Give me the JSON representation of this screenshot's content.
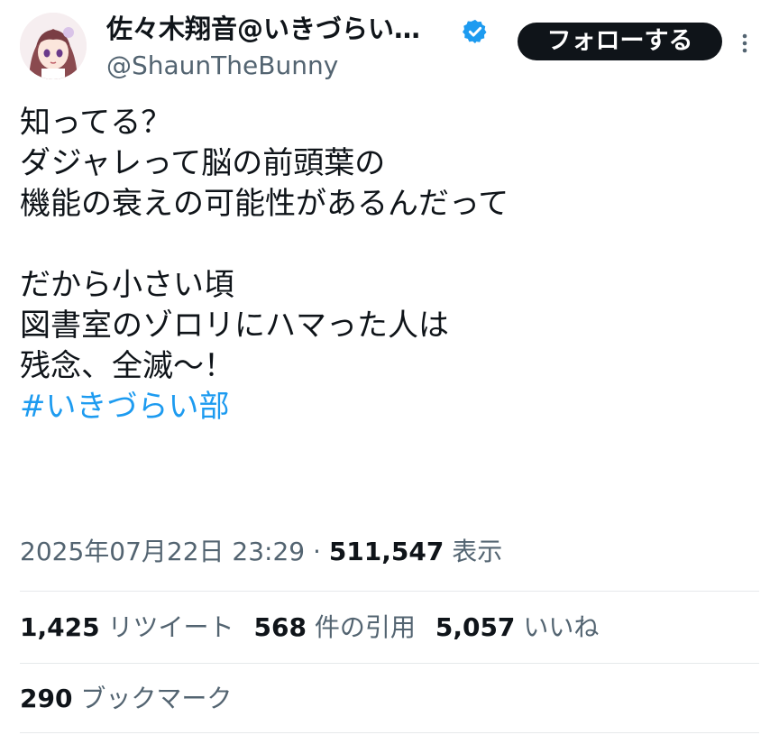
{
  "author": {
    "display_name": "佐々木翔音@いきづらい…",
    "handle": "@ShaunTheBunny",
    "verified": true
  },
  "follow_button": {
    "label": "フォローする"
  },
  "tweet": {
    "lines": [
      "知ってる？",
      "ダジャレって脳の前頭葉の",
      "機能の衰えの可能性があるんだって",
      "",
      "だから小さい頃",
      "図書室のゾロリにハマった人は",
      "残念、全滅～！"
    ],
    "hashtag": "#いきづらい部"
  },
  "meta": {
    "timestamp": "2025年07月22日 23:29",
    "separator": " · ",
    "views_count": "511,547",
    "views_label": " 表示"
  },
  "stats": {
    "retweets": {
      "count": "1,425",
      "label": " リツイート"
    },
    "quotes": {
      "count": "568",
      "label": " 件の引用"
    },
    "likes": {
      "count": "5,057",
      "label": " いいね"
    },
    "bookmarks": {
      "count": "290",
      "label": " ブックマーク"
    }
  },
  "colors": {
    "text": "#0f1419",
    "secondary": "#536471",
    "accent": "#1d9bf0",
    "button_bg": "#0f1419",
    "button_text": "#ffffff",
    "divider": "#e6e9eb"
  },
  "icons": {
    "verified": "verified-badge-icon",
    "more": "more-vertical-icon",
    "avatar": "anime-avatar"
  }
}
